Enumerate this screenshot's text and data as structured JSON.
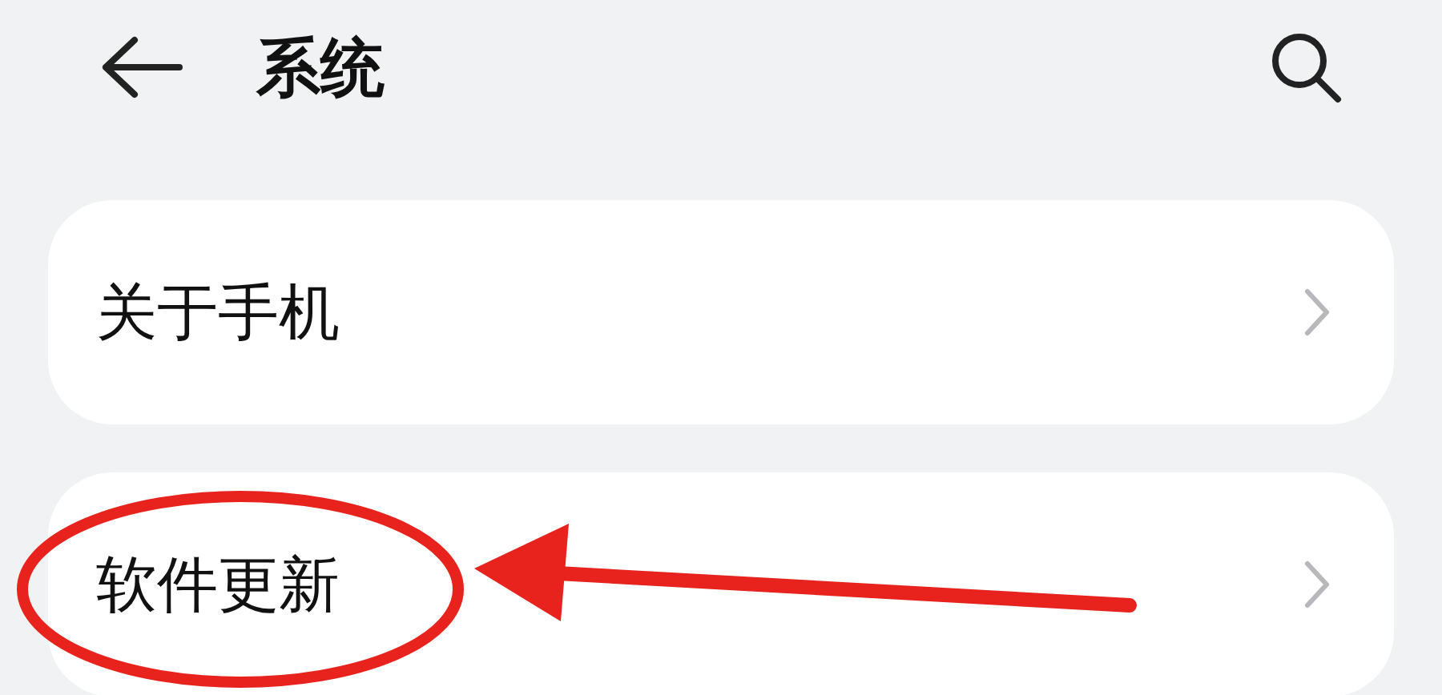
{
  "header": {
    "title": "系统"
  },
  "items": [
    {
      "label": "关于手机"
    },
    {
      "label": "软件更新"
    }
  ],
  "annotations": {
    "highlight_ellipse": true,
    "pointer_arrow": true
  }
}
